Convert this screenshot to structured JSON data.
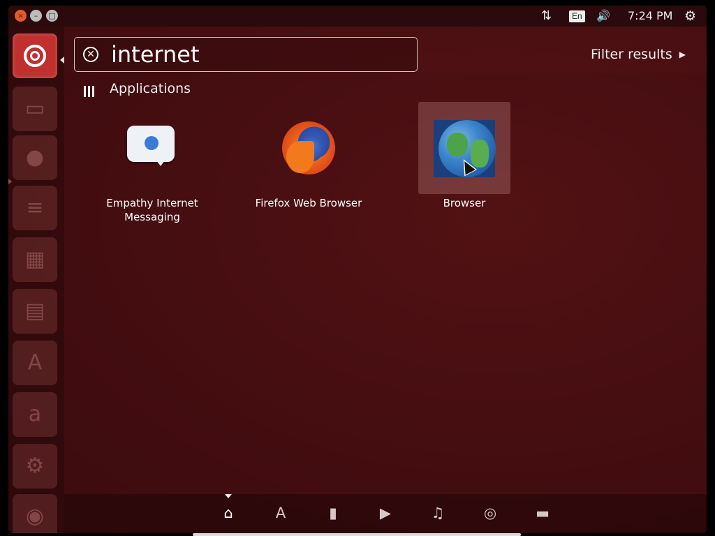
{
  "panel": {
    "window_buttons": [
      "×",
      "–",
      "□"
    ],
    "lang": "En",
    "time": "7:24 PM",
    "net_icon": "⇅",
    "volume_icon": "🔊",
    "power_icon": "⚙"
  },
  "launcher": {
    "items": [
      {
        "name": "ubuntu-home"
      },
      {
        "name": "files-icon",
        "glyph": "▭"
      },
      {
        "name": "firefox-launcher-icon",
        "glyph": "●"
      },
      {
        "name": "writer-icon",
        "glyph": "≡"
      },
      {
        "name": "calc-icon",
        "glyph": "▦"
      },
      {
        "name": "impress-icon",
        "glyph": "▤"
      },
      {
        "name": "software-center-icon",
        "glyph": "A"
      },
      {
        "name": "amazon-icon",
        "glyph": "a"
      },
      {
        "name": "settings-icon",
        "glyph": "⚙"
      },
      {
        "name": "disk-icon",
        "glyph": "◉"
      }
    ]
  },
  "search": {
    "value": "internet"
  },
  "filter": {
    "label": "Filter results"
  },
  "section": {
    "title": "Applications"
  },
  "apps": [
    {
      "label_line1": "Empathy Internet",
      "label_line2": "Messaging"
    },
    {
      "label_line1": "Firefox Web Browser",
      "label_line2": ""
    },
    {
      "label_line1": "Browser",
      "label_line2": ""
    }
  ],
  "lenses": [
    "home",
    "applications",
    "files",
    "video",
    "music",
    "photos",
    "social"
  ],
  "colors": {
    "accent": "#c0302f",
    "background": "#4a0f12"
  }
}
